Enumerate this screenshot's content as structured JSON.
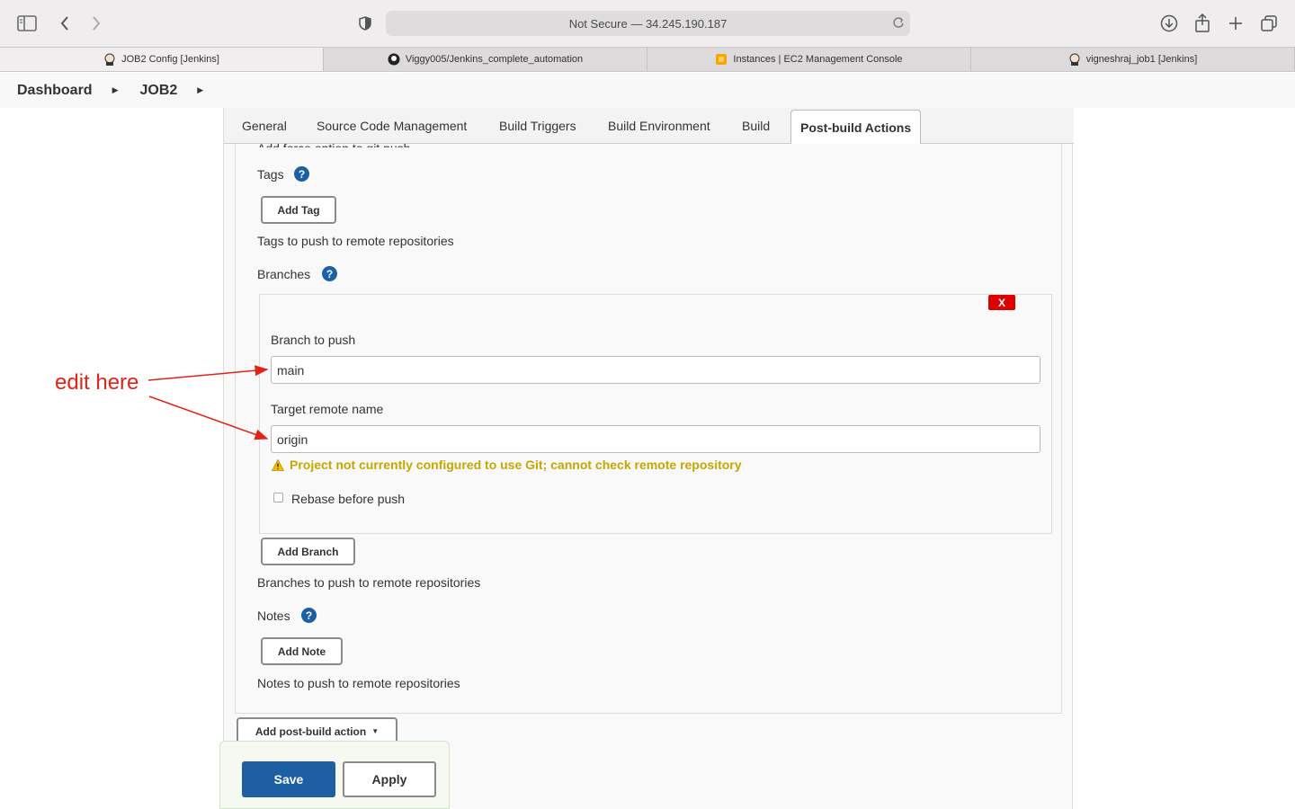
{
  "browser": {
    "address": "Not Secure — 34.245.190.187",
    "tabs": [
      {
        "label": "JOB2 Config [Jenkins]",
        "icon": "jenkins-icon"
      },
      {
        "label": "Viggy005/Jenkins_complete_automation",
        "icon": "github-icon"
      },
      {
        "label": "Instances | EC2 Management Console",
        "icon": "aws-icon"
      },
      {
        "label": "vigneshraj_job1 [Jenkins]",
        "icon": "jenkins-icon"
      }
    ]
  },
  "breadcrumb": {
    "items": [
      "Dashboard",
      "JOB2"
    ]
  },
  "config_tabs": [
    "General",
    "Source Code Management",
    "Build Triggers",
    "Build Environment",
    "Build",
    "Post-build Actions"
  ],
  "active_tab": "Post-build Actions",
  "section": {
    "partial_text": "Add force option to git push",
    "tags": {
      "label": "Tags",
      "button": "Add Tag",
      "description": "Tags to push to remote repositories"
    },
    "branches": {
      "label": "Branches",
      "delete_label": "X",
      "branch_to_push": {
        "label": "Branch to push",
        "value": "main"
      },
      "target_remote": {
        "label": "Target remote name",
        "value": "origin"
      },
      "warning": "Project not currently configured to use Git; cannot check remote repository",
      "rebase": {
        "label": "Rebase before push",
        "checked": false
      },
      "button": "Add Branch",
      "description": "Branches to push to remote repositories"
    },
    "notes": {
      "label": "Notes",
      "button": "Add Note",
      "description": "Notes to push to remote repositories"
    }
  },
  "add_post_build": "Add post-build action",
  "save_label": "Save",
  "apply_label": "Apply",
  "annotation": {
    "text": "edit here",
    "color": "#e2231a"
  },
  "colors": {
    "primary": "#1d5fa2",
    "warning": "#c6a600",
    "danger": "#dd0000"
  }
}
